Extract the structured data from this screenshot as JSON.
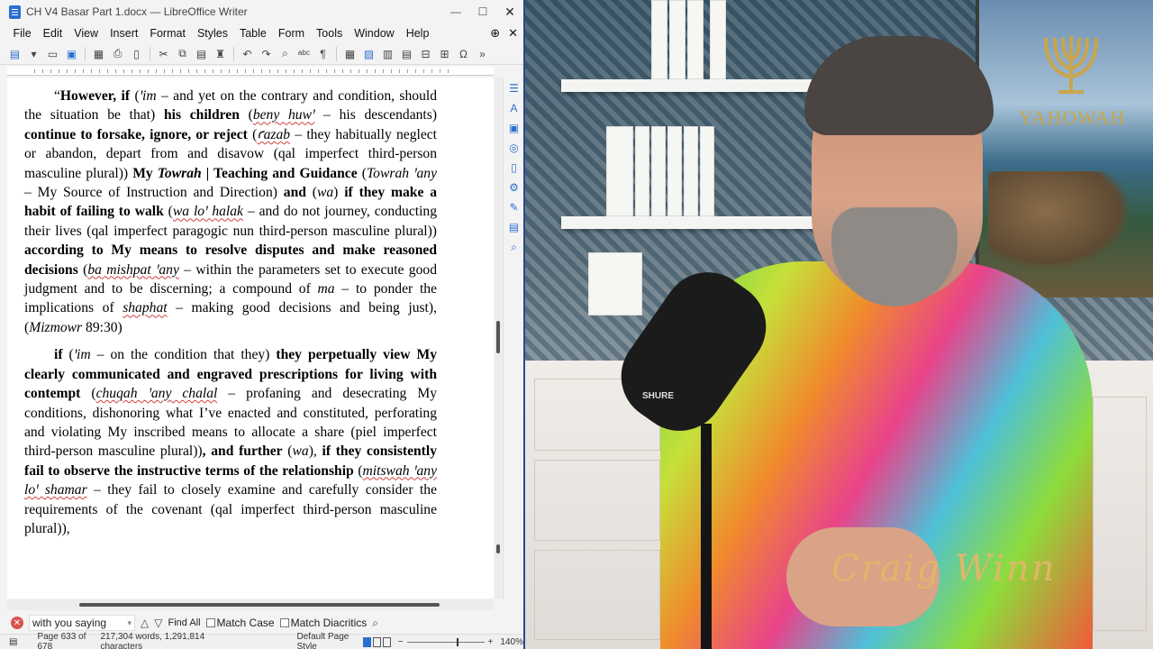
{
  "window": {
    "title": "CH V4 Basar Part 1.docx — LibreOffice Writer",
    "minimize": "—",
    "maximize": "☐",
    "close": "✕"
  },
  "menu": [
    "File",
    "Edit",
    "View",
    "Insert",
    "Format",
    "Styles",
    "Table",
    "Form",
    "Tools",
    "Window",
    "Help"
  ],
  "document": {
    "p1": {
      "open_quote": "“",
      "s1": "However, if",
      "s2": " (",
      "s3": "ꞌim",
      "s4": " – and yet on the contrary and condition, should the situation be that) ",
      "s5": "his children",
      "s6": " (",
      "s7": "beny huwꞌ",
      "s8": " – his descendants) ",
      "s9": "continue to forsake, ignore, or reject",
      "s10": " (",
      "s11": "ꜥazab",
      "s12": " – they habitually neglect or abandon, depart from and disavow (qal imperfect third-person masculine plural)) ",
      "s13": "My ",
      "s14": "Towrah",
      "s15": " | Teaching and Guidance",
      "s16": " (",
      "s17": "Towrah ꞌany",
      "s18": " – My Source of Instruction and Direction) ",
      "s19": "and",
      "s20": " (",
      "s21": "wa",
      "s22": ") ",
      "s23": "if they make a habit of failing to walk",
      "s24": " (",
      "s25": "wa loꞌ halak",
      "s26": " – and do not journey, conducting their lives (qal imperfect paragogic nun third-person masculine plural)) ",
      "s27": "according to My means to resolve disputes and make reasoned decisions",
      "s28": " (",
      "s29": "ba mishpat ꞌany",
      "s30": " – within the parameters set to execute good judgment and to be discerning; a compound of ",
      "s31": "ma",
      "s32": " – to ponder the implications of ",
      "s33": "shaphat",
      "s34": " – making good decisions and being just), (",
      "s35": "Mizmowr",
      "s36": " 89:30)"
    },
    "p2": {
      "s1": "if",
      "s2": " (",
      "s3": "ꞌim",
      "s4": " – on the condition that they) ",
      "s5": "they perpetually view My clearly communicated and engraved prescriptions for living with contempt",
      "s6": " (",
      "s7": "chuqah ꞌany chalal",
      "s8": " – profaning and desecrating My conditions, dishonoring what I’ve enacted and constituted, perforating and violating My inscribed means to allocate a share (piel imperfect third-person masculine plural))",
      "s9": ", and further",
      "s10": " (",
      "s11": "wa",
      "s12": "), ",
      "s13": "if they consistently fail to observe the instructive terms of the relationship",
      "s14": " (",
      "s15": "mitswah ꞌany loꞌ shamar",
      "s16": " – they fail to closely examine and carefully consider the requirements of the covenant (qal imperfect third-person masculine plural)),"
    }
  },
  "findbar": {
    "search_value": "with you saying",
    "find_all": "Find All",
    "match_case": "Match Case",
    "match_diacritics": "Match Diacritics"
  },
  "statusbar": {
    "page": "Page 633 of 678",
    "words": "217,304 words, 1,291,814 characters",
    "page_style": "Default Page Style",
    "zoom_minus": "−",
    "zoom_plus": "+",
    "zoom": "140%"
  },
  "scene": {
    "logo_text": "YAHOWAH",
    "mic_brand": "SHURE",
    "signature": "Craig Winn"
  },
  "colors": {
    "accent": "#2a6fd1",
    "title_border": "#2a4a8a",
    "logo_gold": "#c9a54c"
  }
}
